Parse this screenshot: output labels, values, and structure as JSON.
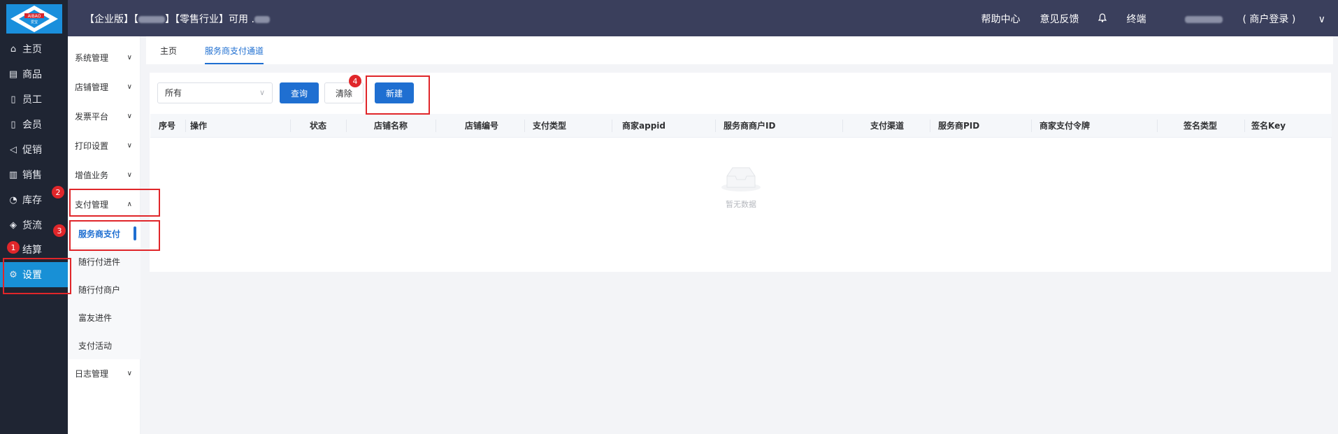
{
  "logo": {
    "text_top": "AIBAO",
    "text_bottom": "爱宝"
  },
  "left_nav": [
    {
      "label": "主页",
      "icon": "home-icon",
      "glyph": "⌂"
    },
    {
      "label": "商品",
      "icon": "goods-icon",
      "glyph": "▤"
    },
    {
      "label": "员工",
      "icon": "employee-icon",
      "glyph": "▯"
    },
    {
      "label": "会员",
      "icon": "member-icon",
      "glyph": "▯"
    },
    {
      "label": "促销",
      "icon": "promotion-icon",
      "glyph": "◁"
    },
    {
      "label": "销售",
      "icon": "sales-chart-icon",
      "glyph": "▥"
    },
    {
      "label": "库存",
      "icon": "inventory-icon",
      "glyph": "◔"
    },
    {
      "label": "货流",
      "icon": "logistics-icon",
      "glyph": "◈"
    },
    {
      "label": "结算",
      "icon": "settlement-icon",
      "glyph": ""
    },
    {
      "label": "设置",
      "icon": "settings-gear-icon",
      "glyph": "⚙"
    }
  ],
  "header": {
    "edition": "【企业版】【",
    "bracket_close": "】【零售行业】可用",
    "dot": ".",
    "help": "帮助中心",
    "feedback": "意见反馈",
    "terminal": "终端",
    "login_mode": "( 商户登录 )",
    "dropdown_glyph": "∨",
    "bell_glyph": "🔔"
  },
  "submenu": [
    {
      "label": "系统管理",
      "chev": "∨"
    },
    {
      "label": "店铺管理",
      "chev": "∨"
    },
    {
      "label": "发票平台",
      "chev": "∨"
    },
    {
      "label": "打印设置",
      "chev": "∨"
    },
    {
      "label": "增值业务",
      "chev": "∨"
    },
    {
      "label": "支付管理",
      "chev": "∧"
    }
  ],
  "submenu_children": [
    {
      "label": "服务商支付"
    },
    {
      "label": "随行付进件"
    },
    {
      "label": "随行付商户"
    },
    {
      "label": "富友进件"
    },
    {
      "label": "支付活动"
    }
  ],
  "submenu_log": {
    "label": "日志管理",
    "chev": "∨"
  },
  "tabs": [
    {
      "label": "主页"
    },
    {
      "label": "服务商支付通道"
    }
  ],
  "filter": {
    "select_value": "所有",
    "caret": "∨",
    "query_label": "查询",
    "clear_label": "清除",
    "new_label": "新建"
  },
  "table": {
    "headers": [
      "序号",
      "操作",
      "状态",
      "店铺名称",
      "店铺编号",
      "支付类型",
      "商家appid",
      "服务商商户ID",
      "支付渠道",
      "服务商PID",
      "商家支付令牌",
      "签名类型",
      "签名Key"
    ],
    "empty_text": "暂无数据"
  },
  "annotations": [
    "1",
    "2",
    "3",
    "4"
  ],
  "colors": {
    "accent": "#1f6fd1",
    "nav_bg": "#1f2533",
    "header_bg": "#3a3f5c",
    "active_nav": "#1890d6",
    "annotation": "#e0262a"
  }
}
